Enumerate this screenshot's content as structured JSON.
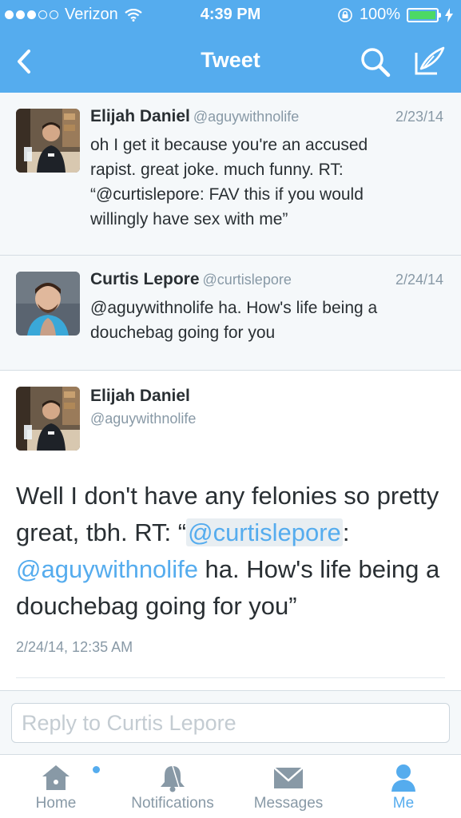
{
  "status_bar": {
    "carrier": "Verizon",
    "time": "4:39 PM",
    "battery": "100%"
  },
  "nav": {
    "title": "Tweet"
  },
  "replies": [
    {
      "name": "Elijah Daniel",
      "handle": "@aguywithnolife",
      "date": "2/23/14",
      "text": "oh I get it because you're an accused rapist. great joke. much funny. RT: “@curtislepore: FAV this if you would willingly have sex with me”"
    },
    {
      "name": "Curtis Lepore",
      "handle": "@curtislepore",
      "date": "2/24/14",
      "text": "@aguywithnolife ha. How's life being a douchebag going for you"
    }
  ],
  "tweet": {
    "name": "Elijah Daniel",
    "handle": "@aguywithnolife",
    "text_before": "Well I don't have any felonies so pretty great, tbh. RT: “",
    "mention1": "@curtislepore",
    "text_mid": ": ",
    "mention2": "@aguywithnolife",
    "text_after": " ha. How's life being a douchebag going for you”",
    "timestamp": "2/24/14, 12:35 AM"
  },
  "reply_box": {
    "placeholder": "Reply to Curtis Lepore"
  },
  "tabs": {
    "home": "Home",
    "notifications": "Notifications",
    "messages": "Messages",
    "me": "Me"
  },
  "colors": {
    "brand": "#55acee",
    "text": "#292f33",
    "muted": "#8899a6"
  }
}
